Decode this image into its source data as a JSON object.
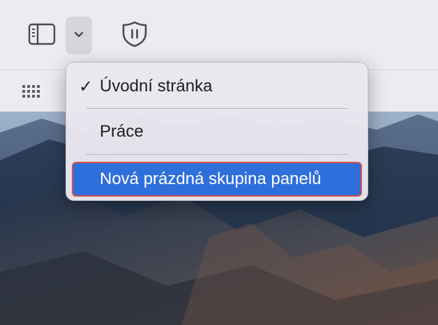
{
  "toolbar": {
    "sidebar_icon": "sidebar-icon",
    "tab_groups_icon": "chevron-down-icon",
    "privacy_icon": "shield-icon",
    "favorites_icon": "grid-icon"
  },
  "menu": {
    "items": [
      {
        "label": "Úvodní stránka",
        "check": "✓",
        "selected": true
      },
      {
        "label": "Práce",
        "check": ""
      },
      {
        "label": "Nová prázdná skupina panelů",
        "check": "",
        "highlighted": true
      }
    ]
  },
  "colors": {
    "highlight": "#2f6fdb",
    "focus_ring": "#d9514c",
    "toolbar_bg": "#ecebf0"
  }
}
